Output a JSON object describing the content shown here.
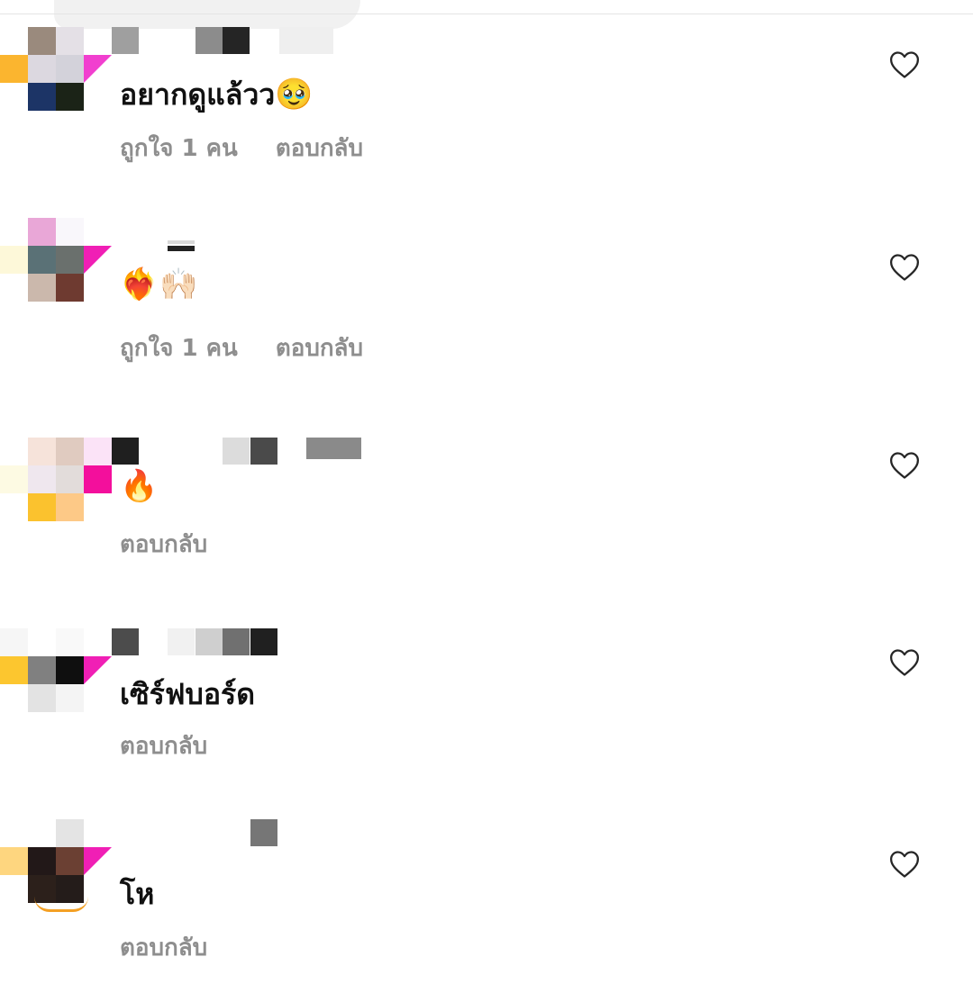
{
  "comments": [
    {
      "text": "อยากดูแล้วว",
      "emoji": "🥹",
      "likes_prefix": "ถูกใจ",
      "likes_count": "1",
      "likes_suffix": "คน",
      "reply_label": "ตอบกลับ",
      "liked": false
    },
    {
      "text": "",
      "emoji": "❤️‍🔥🙌🏻",
      "likes_prefix": "ถูกใจ",
      "likes_count": "1",
      "likes_suffix": "คน",
      "reply_label": "ตอบกลับ",
      "liked": false
    },
    {
      "text": "",
      "emoji": "🔥",
      "reply_label": "ตอบกลับ",
      "liked": false
    },
    {
      "text": "เซิร์ฟบอร์ด",
      "emoji": "",
      "reply_label": "ตอบกลับ",
      "liked": false
    },
    {
      "text": "โห",
      "emoji": "",
      "reply_label": "ตอบกลับ",
      "liked": false
    }
  ],
  "icons": {
    "like": "heart-outline-icon"
  },
  "colors": {
    "secondary_text": "#8e8e8e",
    "primary_text": "#111111",
    "story_ring": "#f01fb5"
  }
}
